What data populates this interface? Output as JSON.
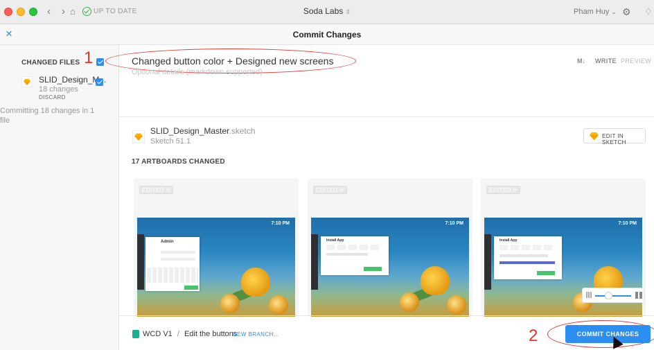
{
  "titlebar": {
    "status": "UP TO DATE",
    "workspace": "Soda Labs",
    "workspace_caret": "⌃",
    "user": "Pham Huy"
  },
  "header": {
    "title": "Commit Changes",
    "close": "×"
  },
  "sidebar": {
    "section_title": "CHANGED FILES",
    "file": {
      "name": "SLID_Design_M...",
      "changes": "18 changes",
      "discard": "DISCARD"
    },
    "summary": "Committing 18 changes in 1 file"
  },
  "annotations": {
    "mark1": "1",
    "mark2": "2"
  },
  "commit_form": {
    "summary": "Changed button color + Designed new screens",
    "description_placeholder": "Optional details (markdown supported)",
    "markdown_icon": "M↓",
    "write_tab": "WRITE",
    "preview_tab": "PREVIEW"
  },
  "document": {
    "name": "SLID_Design_Master",
    "ext": ".sketch",
    "version": "Sketch 51.1",
    "edit_button": "EDIT IN SKETCH"
  },
  "artboards": {
    "title": "17 ARTBOARDS CHANGED",
    "cards": [
      {
        "badge": "EDITED",
        "time": "7:10 PM",
        "panel_title": "Admin"
      },
      {
        "badge": "EDITED",
        "time": "7:10 PM",
        "panel_title": "Install App"
      },
      {
        "badge": "EDITED",
        "time": "7:10 PM",
        "panel_title": "Install App"
      }
    ]
  },
  "footer": {
    "branch": "WCD V1",
    "separator": "/",
    "branch_desc": "Edit the buttons",
    "new_branch": "NEW BRANCH...",
    "commit_button": "COMMIT CHANGES"
  },
  "colors": {
    "accent": "#2b8ef0",
    "annotation": "#e8332a",
    "branch": "#1ab08f"
  }
}
